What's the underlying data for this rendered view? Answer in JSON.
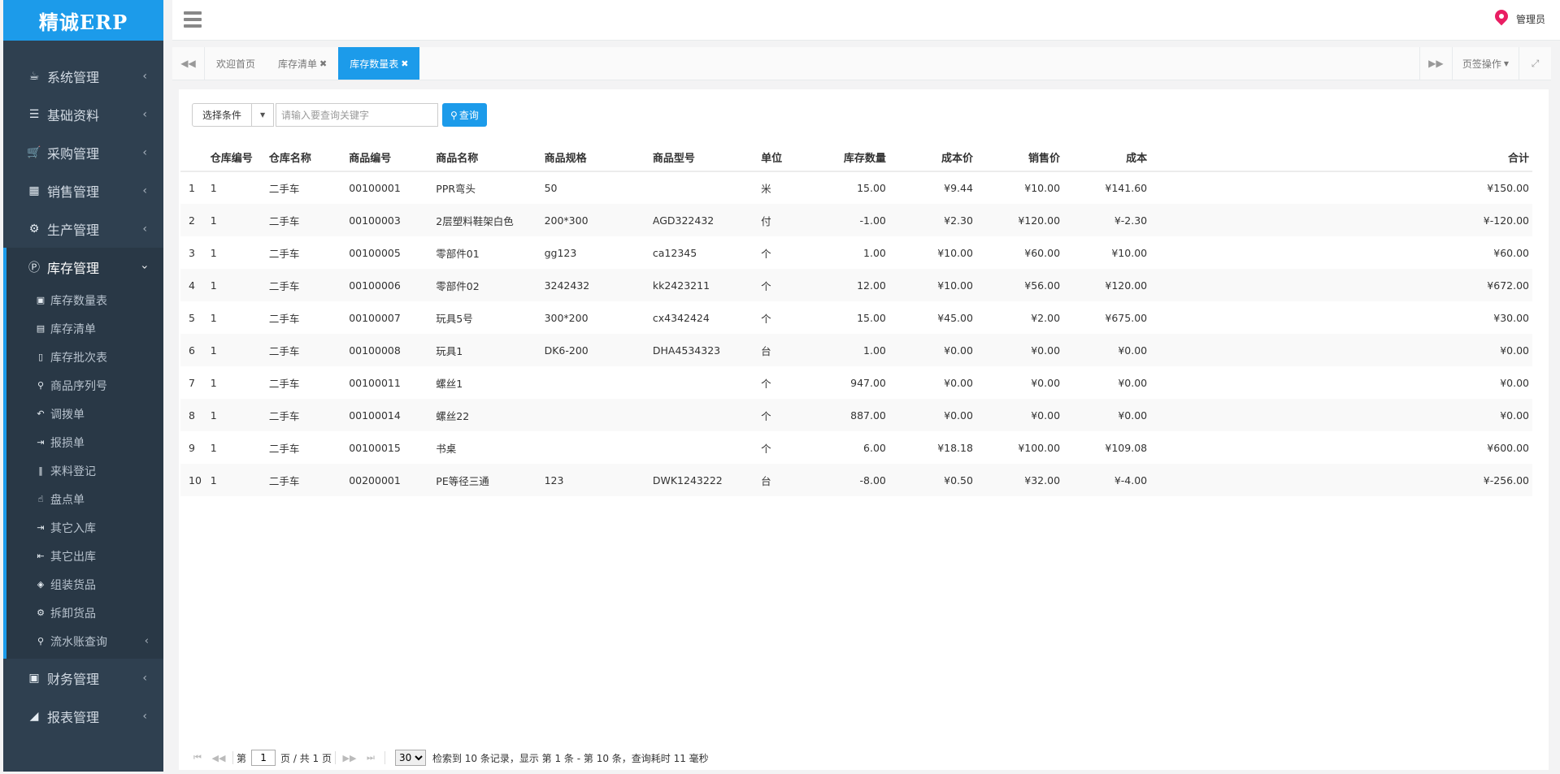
{
  "app": {
    "logo": "精诚ERP",
    "user": "管理员"
  },
  "sidebar": {
    "menu": [
      {
        "label": "系统管理",
        "icon": "coffee-icon",
        "glyph": "☕"
      },
      {
        "label": "基础资料",
        "icon": "list-icon",
        "glyph": "☰"
      },
      {
        "label": "采购管理",
        "icon": "cart-icon",
        "glyph": "🛒"
      },
      {
        "label": "销售管理",
        "icon": "building-icon",
        "glyph": "▦"
      },
      {
        "label": "生产管理",
        "icon": "cubes-icon",
        "glyph": "⚙"
      },
      {
        "label": "库存管理",
        "icon": "parking-icon",
        "glyph": "Ⓟ"
      }
    ],
    "submenu": [
      {
        "label": "库存数量表",
        "icon": "money-icon",
        "glyph": "▣"
      },
      {
        "label": "库存清单",
        "icon": "list-alt-icon",
        "glyph": "▤"
      },
      {
        "label": "库存批次表",
        "icon": "file-icon",
        "glyph": "▯"
      },
      {
        "label": "商品序列号",
        "icon": "search-icon",
        "glyph": "⚲"
      },
      {
        "label": "调拨单",
        "icon": "reply-icon",
        "glyph": "↶"
      },
      {
        "label": "报损单",
        "icon": "sign-in-icon",
        "glyph": "⇥"
      },
      {
        "label": "来料登记",
        "icon": "barcode-icon",
        "glyph": "‖"
      },
      {
        "label": "盘点单",
        "icon": "hand-icon",
        "glyph": "☝"
      },
      {
        "label": "其它入库",
        "icon": "sign-in-icon",
        "glyph": "⇥"
      },
      {
        "label": "其它出库",
        "icon": "sign-out-icon",
        "glyph": "⇤"
      },
      {
        "label": "组装货品",
        "icon": "cube-icon",
        "glyph": "◈"
      },
      {
        "label": "拆卸货品",
        "icon": "cubes-icon",
        "glyph": "⚙"
      },
      {
        "label": "流水账查询",
        "icon": "search-icon",
        "glyph": "⚲"
      }
    ],
    "menu_after": [
      {
        "label": "财务管理",
        "icon": "money-icon",
        "glyph": "▣"
      },
      {
        "label": "报表管理",
        "icon": "area-chart-icon",
        "glyph": "◢"
      }
    ]
  },
  "tabs": [
    {
      "label": "欢迎首页",
      "closable": false
    },
    {
      "label": "库存清单",
      "closable": true
    },
    {
      "label": "库存数量表",
      "closable": true
    }
  ],
  "tab_ops": "页签操作",
  "toolbar": {
    "condition_label": "选择条件",
    "search_placeholder": "请输入要查询关键字",
    "query_label": "查询"
  },
  "table": {
    "headers": [
      "",
      "仓库编号",
      "仓库名称",
      "商品编号",
      "商品名称",
      "商品规格",
      "商品型号",
      "单位",
      "库存数量",
      "成本价",
      "销售价",
      "成本",
      "",
      "合计"
    ],
    "rows": [
      [
        "1",
        "1",
        "二手车",
        "00100001",
        "PPR弯头",
        "50",
        "",
        "米",
        "15.00",
        "¥9.44",
        "¥10.00",
        "¥141.60",
        "",
        "¥150.00"
      ],
      [
        "2",
        "1",
        "二手车",
        "00100003",
        "2层塑料鞋架白色",
        "200*300",
        "AGD322432",
        "付",
        "-1.00",
        "¥2.30",
        "¥120.00",
        "¥-2.30",
        "",
        "¥-120.00"
      ],
      [
        "3",
        "1",
        "二手车",
        "00100005",
        "零部件01",
        "gg123",
        "ca12345",
        "个",
        "1.00",
        "¥10.00",
        "¥60.00",
        "¥10.00",
        "",
        "¥60.00"
      ],
      [
        "4",
        "1",
        "二手车",
        "00100006",
        "零部件02",
        "3242432",
        "kk2423211",
        "个",
        "12.00",
        "¥10.00",
        "¥56.00",
        "¥120.00",
        "",
        "¥672.00"
      ],
      [
        "5",
        "1",
        "二手车",
        "00100007",
        "玩具5号",
        "300*200",
        "cx4342424",
        "个",
        "15.00",
        "¥45.00",
        "¥2.00",
        "¥675.00",
        "",
        "¥30.00"
      ],
      [
        "6",
        "1",
        "二手车",
        "00100008",
        "玩具1",
        "DK6-200",
        "DHA4534323",
        "台",
        "1.00",
        "¥0.00",
        "¥0.00",
        "¥0.00",
        "",
        "¥0.00"
      ],
      [
        "7",
        "1",
        "二手车",
        "00100011",
        "螺丝1",
        "",
        "",
        "个",
        "947.00",
        "¥0.00",
        "¥0.00",
        "¥0.00",
        "",
        "¥0.00"
      ],
      [
        "8",
        "1",
        "二手车",
        "00100014",
        "螺丝22",
        "",
        "",
        "个",
        "887.00",
        "¥0.00",
        "¥0.00",
        "¥0.00",
        "",
        "¥0.00"
      ],
      [
        "9",
        "1",
        "二手车",
        "00100015",
        "书桌",
        "",
        "",
        "个",
        "6.00",
        "¥18.18",
        "¥100.00",
        "¥109.08",
        "",
        "¥600.00"
      ],
      [
        "10",
        "1",
        "二手车",
        "00200001",
        "PE等径三通",
        "123",
        "DWK1243222",
        "台",
        "-8.00",
        "¥0.50",
        "¥32.00",
        "¥-4.00",
        "",
        "¥-256.00"
      ]
    ]
  },
  "pager": {
    "page_prefix": "第",
    "page_value": "1",
    "page_suffix": "页 / 共 1 页",
    "page_size": "30",
    "summary": "检索到 10 条记录，显示 第 1 条 - 第 10 条，查询耗时 11 毫秒"
  }
}
